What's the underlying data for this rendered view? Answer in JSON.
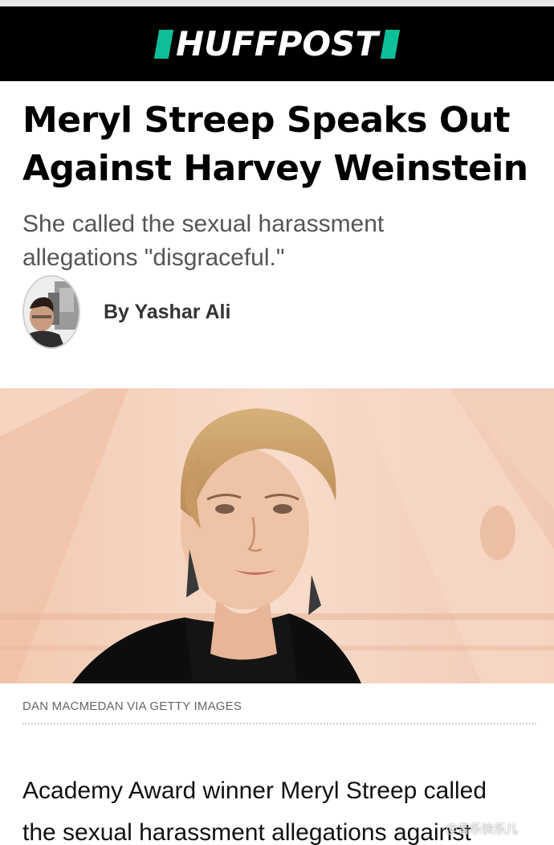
{
  "masthead": {
    "logo_text": "HUFFPOST",
    "logo_accent_color": "#0dbe98",
    "background_color": "#000000"
  },
  "article": {
    "headline": "Meryl Streep Speaks Out Against Harvey Weinstein",
    "subheadline": "She called the sexual harassment allegations \"disgraceful.\"",
    "byline": "By Yashar Ali",
    "image_credit": "DAN MACMEDAN VIA GETTY IMAGES",
    "body_lines": [
      "Academy Award winner Meryl Streep called",
      "the sexual harassment allegations against"
    ]
  },
  "watermark": {
    "text": "@音乐快乐儿"
  }
}
